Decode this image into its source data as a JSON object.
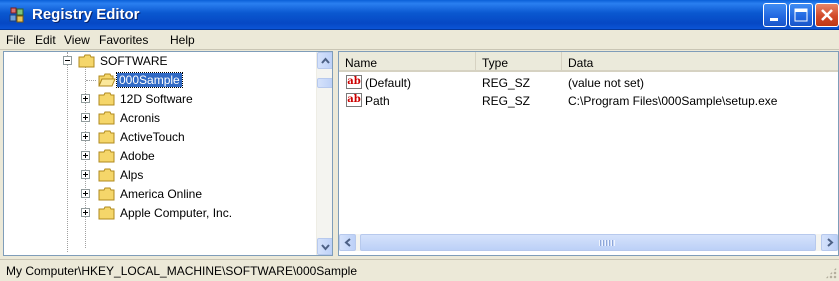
{
  "window": {
    "title": "Registry Editor",
    "colors": {
      "titlebar": "#0a58d0",
      "selection": "#316ac5",
      "close_button": "#d24a2a"
    }
  },
  "menu": {
    "items": [
      {
        "label": "File"
      },
      {
        "label": "Edit"
      },
      {
        "label": "View"
      },
      {
        "label": "Favorites"
      },
      {
        "label": "Help"
      }
    ]
  },
  "tree": {
    "root": {
      "label": "SOFTWARE",
      "expanded": true
    },
    "children": [
      {
        "label": "000Sample",
        "selected": true,
        "icon": "open-folder-icon"
      },
      {
        "label": "12D Software",
        "icon": "folder-icon"
      },
      {
        "label": "Acronis",
        "icon": "folder-icon"
      },
      {
        "label": "ActiveTouch",
        "icon": "folder-icon"
      },
      {
        "label": "Adobe",
        "icon": "folder-icon"
      },
      {
        "label": "Alps",
        "icon": "folder-icon"
      },
      {
        "label": "America Online",
        "icon": "folder-icon"
      },
      {
        "label": "Apple Computer, Inc.",
        "icon": "folder-icon"
      }
    ]
  },
  "list": {
    "columns": [
      {
        "label": "Name"
      },
      {
        "label": "Type"
      },
      {
        "label": "Data"
      }
    ],
    "rows": [
      {
        "name": "(Default)",
        "type": "REG_SZ",
        "data": "(value not set)",
        "icon": "string-value-icon"
      },
      {
        "name": "Path",
        "type": "REG_SZ",
        "data": "C:\\Program Files\\000Sample\\setup.exe",
        "icon": "string-value-icon"
      }
    ]
  },
  "status": {
    "path": "My Computer\\HKEY_LOCAL_MACHINE\\SOFTWARE\\000Sample"
  }
}
